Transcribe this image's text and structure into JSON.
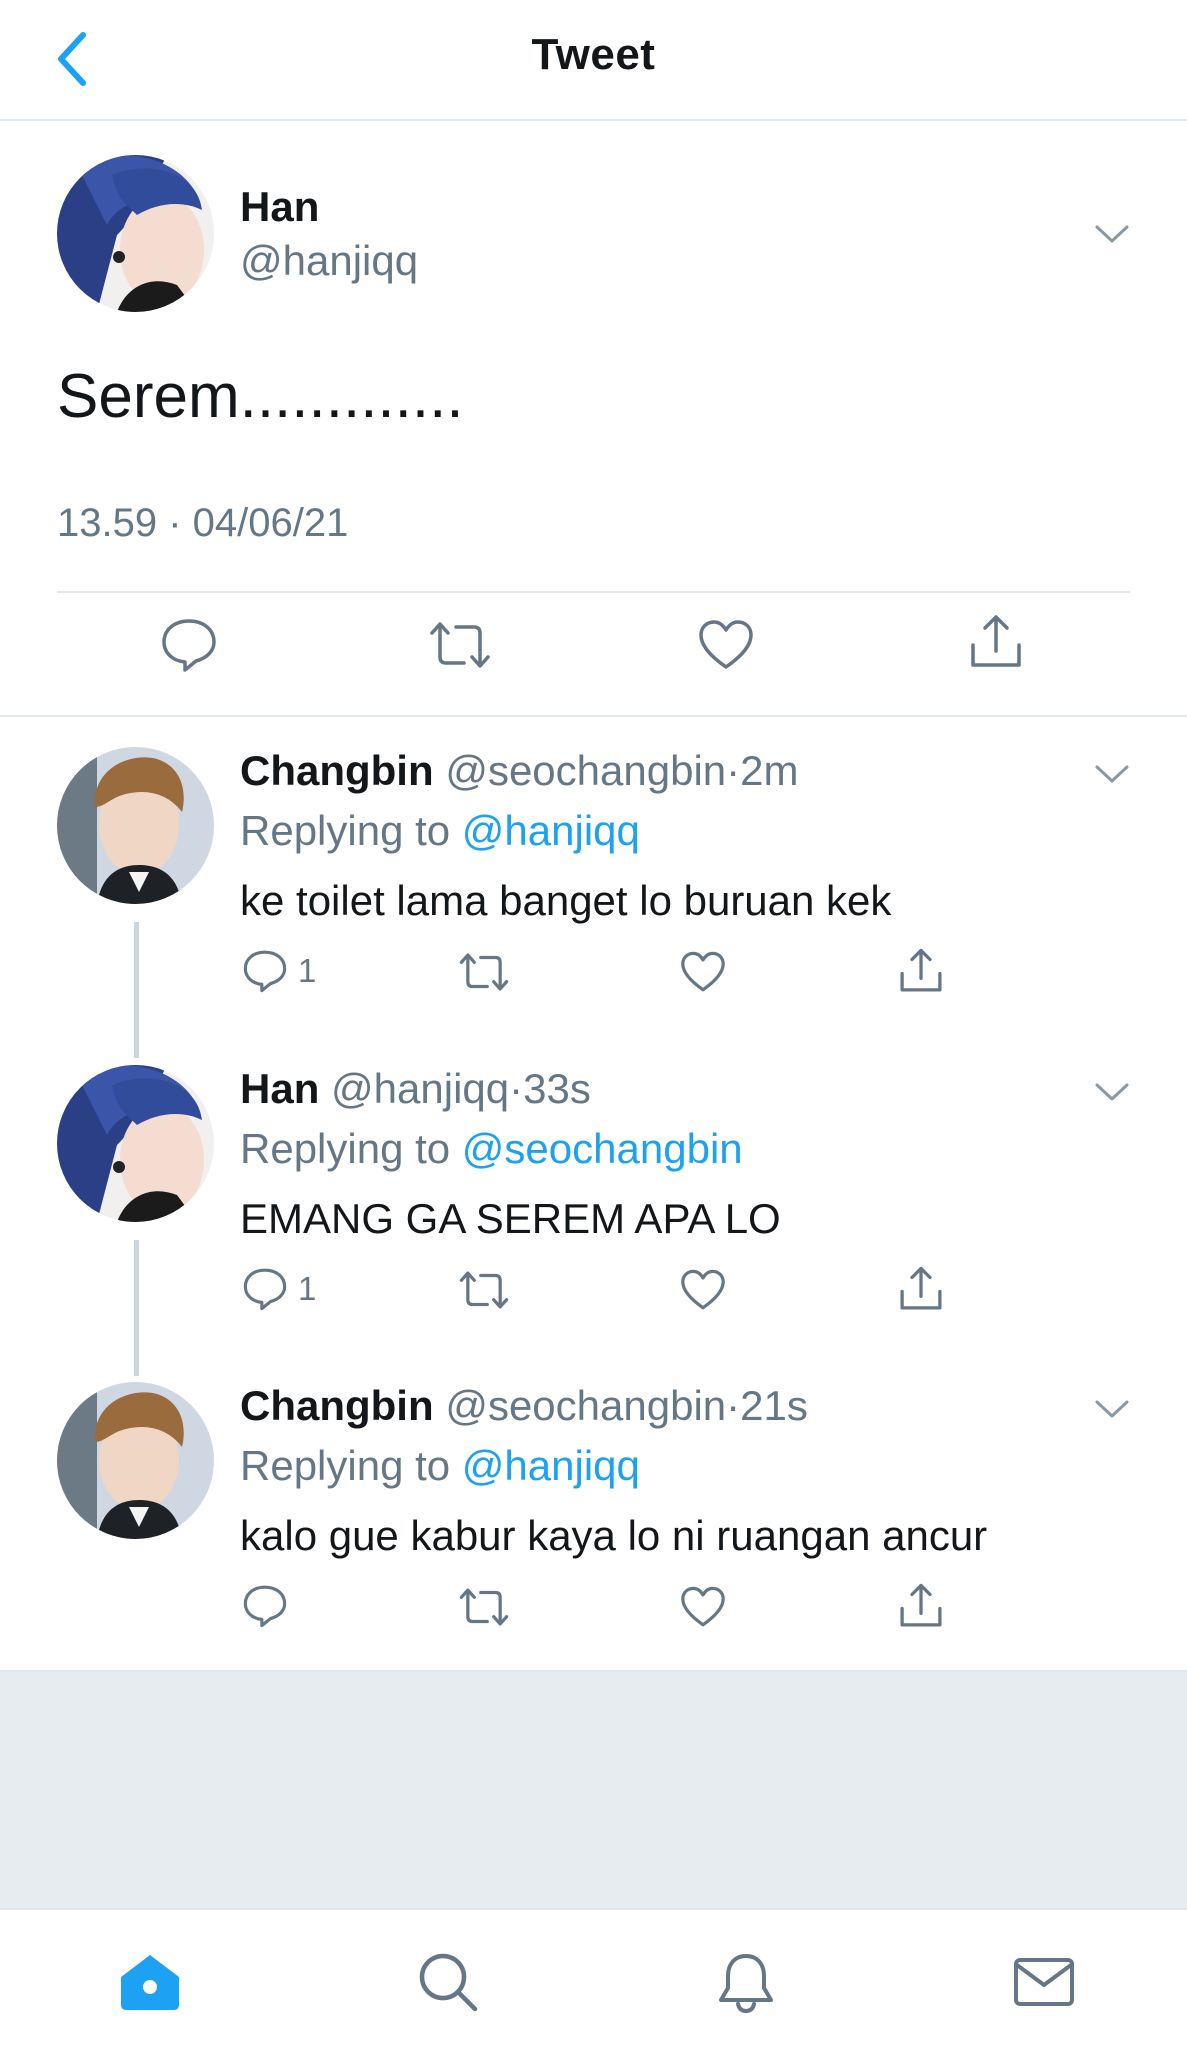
{
  "header": {
    "title": "Tweet",
    "back_icon": "chevron-left-icon"
  },
  "colors": {
    "accent": "#1da1f2",
    "text": "#14171a",
    "muted": "#657786",
    "divider": "#e1e8ed",
    "background_gray": "#e6ecf0"
  },
  "main_tweet": {
    "name": "Han",
    "handle": "@hanjiqq",
    "text": "Serem.............",
    "timestamp": "13.59 · 04/06/21",
    "actions": [
      "reply-icon",
      "retweet-icon",
      "like-icon",
      "share-icon"
    ]
  },
  "replies": [
    {
      "name": "Changbin",
      "handle": "@seochangbin",
      "dot": "·",
      "time": "2m",
      "replying_label": "Replying to",
      "replying_to": "@hanjiqq",
      "text": "ke toilet lama banget lo buruan kek",
      "reply_count": "1"
    },
    {
      "name": "Han",
      "handle": "@hanjiqq",
      "dot": "·",
      "time": "33s",
      "replying_label": "Replying to",
      "replying_to": "@seochangbin",
      "text": "EMANG GA SEREM APA LO",
      "reply_count": "1"
    },
    {
      "name": "Changbin",
      "handle": "@seochangbin",
      "dot": "·",
      "time": "21s",
      "replying_label": "Replying to",
      "replying_to": "@hanjiqq",
      "text": "kalo gue kabur kaya lo ni ruangan ancur",
      "reply_count": ""
    }
  ],
  "tabbar": {
    "items": [
      "home-icon",
      "search-icon",
      "notifications-icon",
      "messages-icon"
    ],
    "active": "home-icon"
  }
}
